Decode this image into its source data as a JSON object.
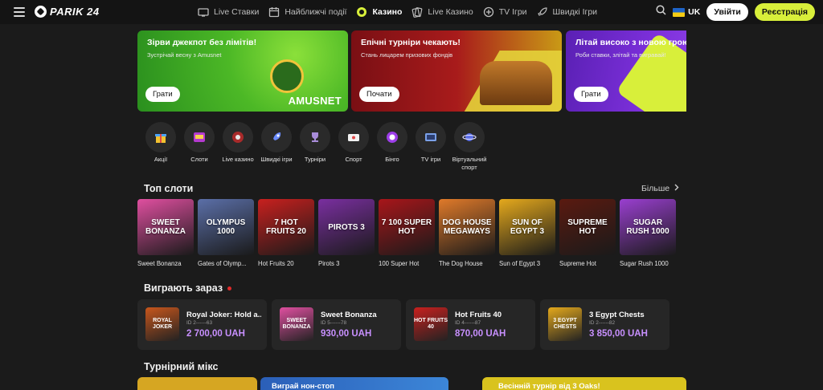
{
  "header": {
    "logo": "PARIK 24",
    "nav": [
      {
        "label": "Live Ставки",
        "icon": "tv-icon"
      },
      {
        "label": "Найближчі події",
        "icon": "calendar-icon"
      },
      {
        "label": "Казино",
        "icon": "casino-chip-icon",
        "active": true
      },
      {
        "label": "Live Казино",
        "icon": "cards-icon"
      },
      {
        "label": "TV Ігри",
        "icon": "tv-games-icon"
      },
      {
        "label": "Швидкі Ігри",
        "icon": "rocket-icon"
      }
    ],
    "lang": "UK",
    "login": "Увійти",
    "register": "Реєстрація"
  },
  "banners": [
    {
      "title": "Зірви джекпот без лімітів!",
      "subtitle": "Зустрічай весну з Amusnet",
      "button": "Грати",
      "brand": "AMUSNET"
    },
    {
      "title": "Епічні турніри чекають!",
      "subtitle": "Стань лицарем призових фондів",
      "button": "Почати"
    },
    {
      "title": "Літай високо з новою грою",
      "subtitle": "Роби ставки, злітай та вигравай!",
      "button": "Грати"
    }
  ],
  "categories": [
    {
      "label": "Акції",
      "icon": "gift-icon"
    },
    {
      "label": "Слоти",
      "icon": "slot-machine-icon"
    },
    {
      "label": "Live казино",
      "icon": "roulette-icon"
    },
    {
      "label": "Швидкі ігри",
      "icon": "rocket-icon"
    },
    {
      "label": "Турніри",
      "icon": "trophy-icon"
    },
    {
      "label": "Спорт",
      "icon": "ticket-icon"
    },
    {
      "label": "Бінго",
      "icon": "bingo-ball-icon"
    },
    {
      "label": "TV ігри",
      "icon": "tv-icon"
    },
    {
      "label": "Віртуальний спорт",
      "icon": "planet-icon"
    }
  ],
  "top_slots": {
    "title": "Топ слоти",
    "more": "Більше",
    "items": [
      {
        "name": "Sweet Bonanza",
        "art": "SWEET BONANZA",
        "color": "#e04fa0"
      },
      {
        "name": "Gates of Olymp...",
        "art": "OLYMPUS 1000",
        "color": "#5b6fa8"
      },
      {
        "name": "Hot Fruits 20",
        "art": "7 HOT FRUITS 20",
        "color": "#c8201e"
      },
      {
        "name": "Pirots 3",
        "art": "PIROTS 3",
        "color": "#7a2fa0"
      },
      {
        "name": "100 Super Hot",
        "art": "7 100 SUPER HOT",
        "color": "#a8161a"
      },
      {
        "name": "The Dog House",
        "art": "DOG HOUSE MEGAWAYS",
        "color": "#e07a2a"
      },
      {
        "name": "Sun of Egypt 3",
        "art": "SUN OF EGYPT 3",
        "color": "#e5a91c"
      },
      {
        "name": "Supreme Hot",
        "art": "SUPREME HOT",
        "color": "#5a1a10"
      },
      {
        "name": "Sugar Rush 1000",
        "art": "SUGAR RUSH 1000",
        "color": "#9a3fd0"
      }
    ]
  },
  "recent_wins": {
    "title": "Виграють зараз",
    "items": [
      {
        "name": "Royal Joker: Hold a...",
        "id": "ID 2------63",
        "amount": "2 700,00 UAH",
        "art": "ROYAL JOKER",
        "color": "#c8561c"
      },
      {
        "name": "Sweet Bonanza",
        "id": "ID 5------78",
        "amount": "930,00 UAH",
        "art": "SWEET BONANZA",
        "color": "#e04fa0"
      },
      {
        "name": "Hot Fruits 40",
        "id": "ID 4------87",
        "amount": "870,00 UAH",
        "art": "HOT FRUITS 40",
        "color": "#c8201e"
      },
      {
        "name": "3 Egypt Chests",
        "id": "ID 2------82",
        "amount": "3 850,00 UAH",
        "art": "3 EGYPT CHESTS",
        "color": "#e5a91c"
      }
    ]
  },
  "tournaments": {
    "title": "Турнірний мікс",
    "items": [
      {
        "label": ""
      },
      {
        "label": "Виграй нон-стоп"
      },
      {
        "label": "Весінній турнір від 3 Oaks!"
      }
    ]
  }
}
